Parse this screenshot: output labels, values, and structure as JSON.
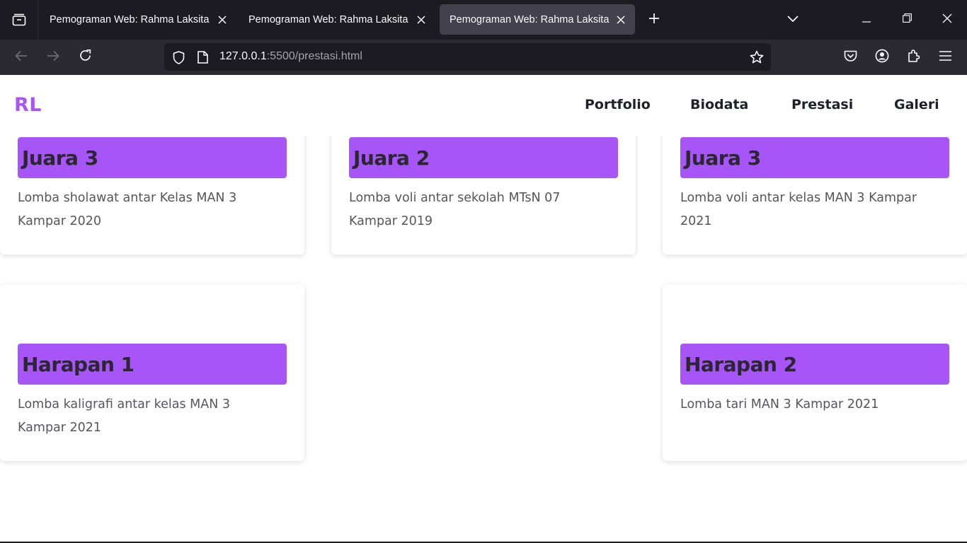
{
  "browser": {
    "tabs": [
      {
        "title": "Pemograman Web: Rahma Laksita"
      },
      {
        "title": "Pemograman Web: Rahma Laksita"
      },
      {
        "title": "Pemograman Web: Rahma Laksita"
      }
    ],
    "active_tab_index": 2,
    "url_host": "127.0.0.1",
    "url_rest": ":5500/prestasi.html"
  },
  "site": {
    "logo": "RL",
    "menu": [
      "Portfolio",
      "Biodata",
      "Prestasi",
      "Galeri"
    ]
  },
  "cards": [
    {
      "title": "Juara 3",
      "desc": "Lomba sholawat antar Kelas MAN 3 Kampar 2020"
    },
    {
      "title": "Juara 2",
      "desc": "Lomba voli antar sekolah MTsN 07 Kampar 2019"
    },
    {
      "title": "Juara 3",
      "desc": "Lomba voli antar kelas MAN 3 Kampar 2021"
    },
    {
      "title": "Harapan 1",
      "desc": "Lomba kaligrafi antar kelas MAN 3 Kampar 2021"
    },
    {
      "title": "Harapan 2",
      "desc": "Lomba tari MAN 3 Kampar 2021"
    }
  ],
  "colors": {
    "accent": "#a855f7",
    "chrome_dark": "#1c1b22",
    "chrome_toolbar": "#2b2a33",
    "active_tab": "#42414d"
  }
}
